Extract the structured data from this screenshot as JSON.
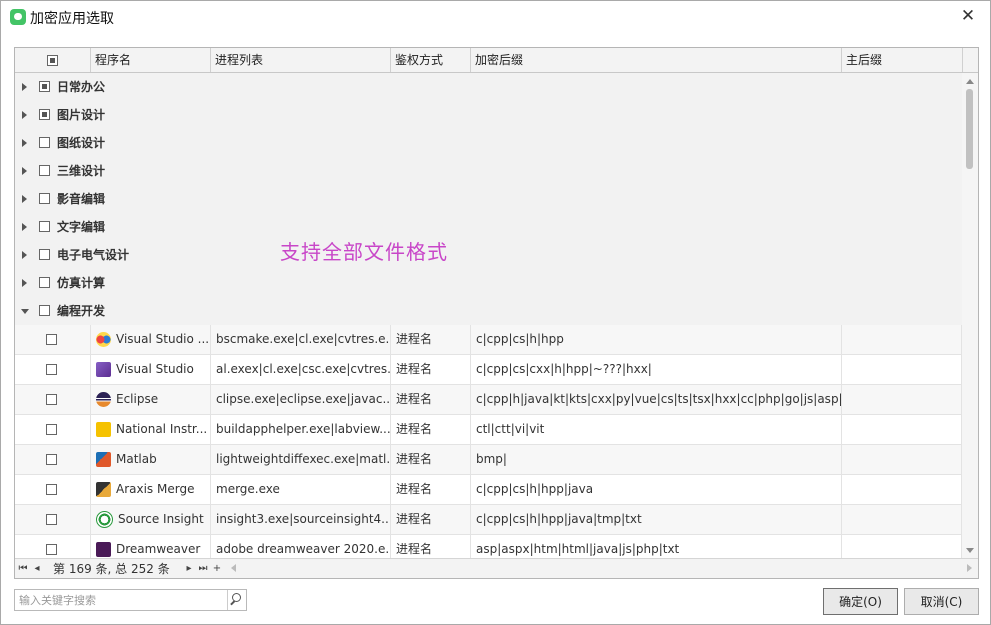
{
  "window": {
    "title": "加密应用选取",
    "close_glyph": "✕"
  },
  "columns": [
    "程序名",
    "进程列表",
    "鉴权方式",
    "加密后缀",
    "主后缀"
  ],
  "groups": [
    {
      "label": "日常办公",
      "checked": "partial"
    },
    {
      "label": "图片设计",
      "checked": "partial"
    },
    {
      "label": "图纸设计",
      "checked": "none"
    },
    {
      "label": "三维设计",
      "checked": "none"
    },
    {
      "label": "影音编辑",
      "checked": "none"
    },
    {
      "label": "文字编辑",
      "checked": "none"
    },
    {
      "label": "电子电气设计",
      "checked": "none"
    },
    {
      "label": "仿真计算",
      "checked": "none"
    },
    {
      "label": "编程开发",
      "checked": "none",
      "expanded": true
    }
  ],
  "rows": [
    {
      "name": "Visual Studio ...",
      "icon": "visual-studio-code-icon",
      "proc": "bscmake.exe|cl.exe|cvtres.e...",
      "auth": "进程名",
      "suffix": "c|cpp|cs|h|hpp",
      "main": ""
    },
    {
      "name": "Visual Studio",
      "icon": "visual-studio-icon",
      "proc": "al.exex|cl.exe|csc.exe|cvtres....",
      "auth": "进程名",
      "suffix": "c|cpp|cs|cxx|h|hpp|~???|hxx|",
      "main": ""
    },
    {
      "name": "Eclipse",
      "icon": "eclipse-icon",
      "proc": "clipse.exe|eclipse.exe|javac....",
      "auth": "进程名",
      "suffix": "c|cpp|h|java|kt|kts|cxx|py|vue|cs|ts|tsx|hxx|cc|php|go|js|asp|jsp|",
      "main": ""
    },
    {
      "name": "National Instr...",
      "icon": "labview-icon",
      "proc": "buildapphelper.exe|labview....",
      "auth": "进程名",
      "suffix": "ctl|ctt|vi|vit",
      "main": ""
    },
    {
      "name": "Matlab",
      "icon": "matlab-icon",
      "proc": "lightweightdiffexec.exe|matl...",
      "auth": "进程名",
      "suffix": "bmp|",
      "main": ""
    },
    {
      "name": "Araxis Merge",
      "icon": "araxis-merge-icon",
      "proc": "merge.exe",
      "auth": "进程名",
      "suffix": "c|cpp|cs|h|hpp|java",
      "main": ""
    },
    {
      "name": "Source Insight",
      "icon": "source-insight-icon",
      "proc": "insight3.exe|sourceinsight4....",
      "auth": "进程名",
      "suffix": "c|cpp|cs|h|hpp|java|tmp|txt",
      "main": ""
    },
    {
      "name": "Dreamweaver",
      "icon": "dreamweaver-icon",
      "proc": "adobe dreamweaver 2020.e...",
      "auth": "进程名",
      "suffix": "asp|aspx|htm|html|java|js|php|txt",
      "main": ""
    }
  ],
  "watermark": "支持全部文件格式",
  "pager": {
    "info": "第 169 条, 总 252 条"
  },
  "search": {
    "placeholder": "输入关键字搜索",
    "value": ""
  },
  "buttons": {
    "ok": "确定(O)",
    "cancel": "取消(C)"
  },
  "colors": {
    "watermark": "#c846c8",
    "vs_code_blue": "#2b7bd5",
    "vs_purple": "#865fc5",
    "dreamweaver": "#4a1a57"
  }
}
